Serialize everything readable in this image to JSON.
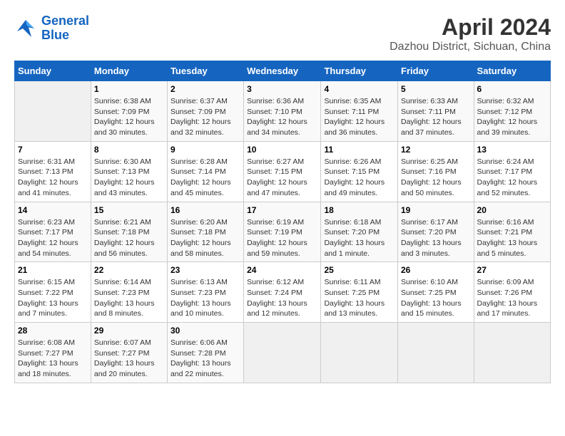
{
  "header": {
    "logo_line1": "General",
    "logo_line2": "Blue",
    "title": "April 2024",
    "subtitle": "Dazhou District, Sichuan, China"
  },
  "days_of_week": [
    "Sunday",
    "Monday",
    "Tuesday",
    "Wednesday",
    "Thursday",
    "Friday",
    "Saturday"
  ],
  "weeks": [
    [
      {
        "day": "",
        "content": ""
      },
      {
        "day": "1",
        "content": "Sunrise: 6:38 AM\nSunset: 7:09 PM\nDaylight: 12 hours\nand 30 minutes."
      },
      {
        "day": "2",
        "content": "Sunrise: 6:37 AM\nSunset: 7:09 PM\nDaylight: 12 hours\nand 32 minutes."
      },
      {
        "day": "3",
        "content": "Sunrise: 6:36 AM\nSunset: 7:10 PM\nDaylight: 12 hours\nand 34 minutes."
      },
      {
        "day": "4",
        "content": "Sunrise: 6:35 AM\nSunset: 7:11 PM\nDaylight: 12 hours\nand 36 minutes."
      },
      {
        "day": "5",
        "content": "Sunrise: 6:33 AM\nSunset: 7:11 PM\nDaylight: 12 hours\nand 37 minutes."
      },
      {
        "day": "6",
        "content": "Sunrise: 6:32 AM\nSunset: 7:12 PM\nDaylight: 12 hours\nand 39 minutes."
      }
    ],
    [
      {
        "day": "7",
        "content": "Sunrise: 6:31 AM\nSunset: 7:13 PM\nDaylight: 12 hours\nand 41 minutes."
      },
      {
        "day": "8",
        "content": "Sunrise: 6:30 AM\nSunset: 7:13 PM\nDaylight: 12 hours\nand 43 minutes."
      },
      {
        "day": "9",
        "content": "Sunrise: 6:28 AM\nSunset: 7:14 PM\nDaylight: 12 hours\nand 45 minutes."
      },
      {
        "day": "10",
        "content": "Sunrise: 6:27 AM\nSunset: 7:15 PM\nDaylight: 12 hours\nand 47 minutes."
      },
      {
        "day": "11",
        "content": "Sunrise: 6:26 AM\nSunset: 7:15 PM\nDaylight: 12 hours\nand 49 minutes."
      },
      {
        "day": "12",
        "content": "Sunrise: 6:25 AM\nSunset: 7:16 PM\nDaylight: 12 hours\nand 50 minutes."
      },
      {
        "day": "13",
        "content": "Sunrise: 6:24 AM\nSunset: 7:17 PM\nDaylight: 12 hours\nand 52 minutes."
      }
    ],
    [
      {
        "day": "14",
        "content": "Sunrise: 6:23 AM\nSunset: 7:17 PM\nDaylight: 12 hours\nand 54 minutes."
      },
      {
        "day": "15",
        "content": "Sunrise: 6:21 AM\nSunset: 7:18 PM\nDaylight: 12 hours\nand 56 minutes."
      },
      {
        "day": "16",
        "content": "Sunrise: 6:20 AM\nSunset: 7:18 PM\nDaylight: 12 hours\nand 58 minutes."
      },
      {
        "day": "17",
        "content": "Sunrise: 6:19 AM\nSunset: 7:19 PM\nDaylight: 12 hours\nand 59 minutes."
      },
      {
        "day": "18",
        "content": "Sunrise: 6:18 AM\nSunset: 7:20 PM\nDaylight: 13 hours\nand 1 minute."
      },
      {
        "day": "19",
        "content": "Sunrise: 6:17 AM\nSunset: 7:20 PM\nDaylight: 13 hours\nand 3 minutes."
      },
      {
        "day": "20",
        "content": "Sunrise: 6:16 AM\nSunset: 7:21 PM\nDaylight: 13 hours\nand 5 minutes."
      }
    ],
    [
      {
        "day": "21",
        "content": "Sunrise: 6:15 AM\nSunset: 7:22 PM\nDaylight: 13 hours\nand 7 minutes."
      },
      {
        "day": "22",
        "content": "Sunrise: 6:14 AM\nSunset: 7:23 PM\nDaylight: 13 hours\nand 8 minutes."
      },
      {
        "day": "23",
        "content": "Sunrise: 6:13 AM\nSunset: 7:23 PM\nDaylight: 13 hours\nand 10 minutes."
      },
      {
        "day": "24",
        "content": "Sunrise: 6:12 AM\nSunset: 7:24 PM\nDaylight: 13 hours\nand 12 minutes."
      },
      {
        "day": "25",
        "content": "Sunrise: 6:11 AM\nSunset: 7:25 PM\nDaylight: 13 hours\nand 13 minutes."
      },
      {
        "day": "26",
        "content": "Sunrise: 6:10 AM\nSunset: 7:25 PM\nDaylight: 13 hours\nand 15 minutes."
      },
      {
        "day": "27",
        "content": "Sunrise: 6:09 AM\nSunset: 7:26 PM\nDaylight: 13 hours\nand 17 minutes."
      }
    ],
    [
      {
        "day": "28",
        "content": "Sunrise: 6:08 AM\nSunset: 7:27 PM\nDaylight: 13 hours\nand 18 minutes."
      },
      {
        "day": "29",
        "content": "Sunrise: 6:07 AM\nSunset: 7:27 PM\nDaylight: 13 hours\nand 20 minutes."
      },
      {
        "day": "30",
        "content": "Sunrise: 6:06 AM\nSunset: 7:28 PM\nDaylight: 13 hours\nand 22 minutes."
      },
      {
        "day": "",
        "content": ""
      },
      {
        "day": "",
        "content": ""
      },
      {
        "day": "",
        "content": ""
      },
      {
        "day": "",
        "content": ""
      }
    ]
  ]
}
